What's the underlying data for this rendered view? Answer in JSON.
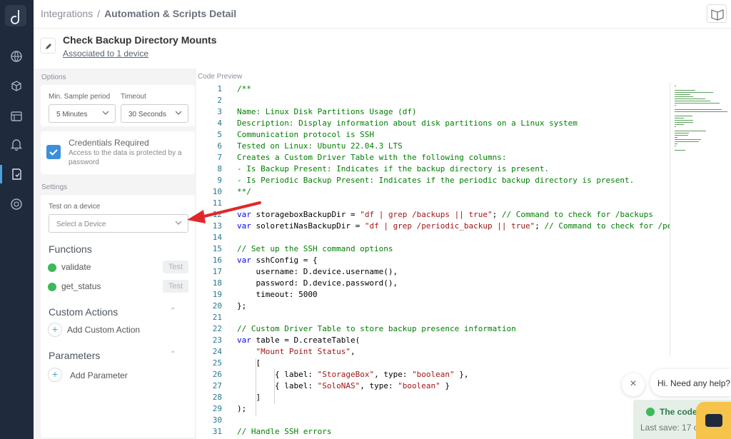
{
  "breadcrumb": {
    "parent": "Integrations",
    "separator": "/",
    "current": "Automation & Scripts Detail"
  },
  "script": {
    "title": "Check Backup Directory Mounts",
    "association": "Associated to 1 device"
  },
  "options": {
    "section_label": "Options",
    "min_sample_label": "Min. Sample period",
    "min_sample_value": "5 Minutes",
    "timeout_label": "Timeout",
    "timeout_value": "30 Seconds",
    "credentials_title": "Credentials Required",
    "credentials_desc": "Access to the data is protected by a password"
  },
  "settings": {
    "section_label": "Settings",
    "test_label": "Test on a device",
    "device_placeholder": "Select a Device"
  },
  "functions": {
    "header": "Functions",
    "items": [
      {
        "name": "validate",
        "test_label": "Test"
      },
      {
        "name": "get_status",
        "test_label": "Test"
      }
    ]
  },
  "custom_actions": {
    "header": "Custom Actions",
    "add_label": "Add Custom Action"
  },
  "parameters": {
    "header": "Parameters",
    "add_label": "Add Parameter"
  },
  "code_preview": {
    "label": "Code Preview",
    "lines": [
      "/**",
      "",
      "Name: Linux Disk Partitions Usage (df)",
      "Description: Display information about disk partitions on a Linux system",
      "Communication protocol is SSH",
      "Tested on Linux: Ubuntu 22.04.3 LTS",
      "Creates a Custom Driver Table with the following columns:",
      "- Is Backup Present: Indicates if the backup directory is present.",
      "- Is Periodic Backup Present: Indicates if the periodic backup directory is present.",
      "**/",
      "",
      "var storageboxBackupDir = \"df | grep /backups || true\"; // Command to check for /backups",
      "var soloretiNasBackupDir = \"df | grep /periodic_backup || true\"; // Command to check for /periodic_backup",
      "",
      "// Set up the SSH command options",
      "var sshConfig = {",
      "    username: D.device.username(),",
      "    password: D.device.password(),",
      "    timeout: 5000",
      "};",
      "",
      "// Custom Driver Table to store backup presence information",
      "var table = D.createTable(",
      "    \"Mount Point Status\",",
      "    [",
      "        { label: \"StorageBox\", type: \"boolean\" },",
      "        { label: \"SoloNAS\", type: \"boolean\" }",
      "    ]",
      ");",
      "",
      "// Handle SSH errors"
    ]
  },
  "chat": {
    "help_text": "Hi. Need any help?",
    "close_label": "×"
  },
  "toast": {
    "title": "The code",
    "subtitle": "Last save: 17 c"
  }
}
